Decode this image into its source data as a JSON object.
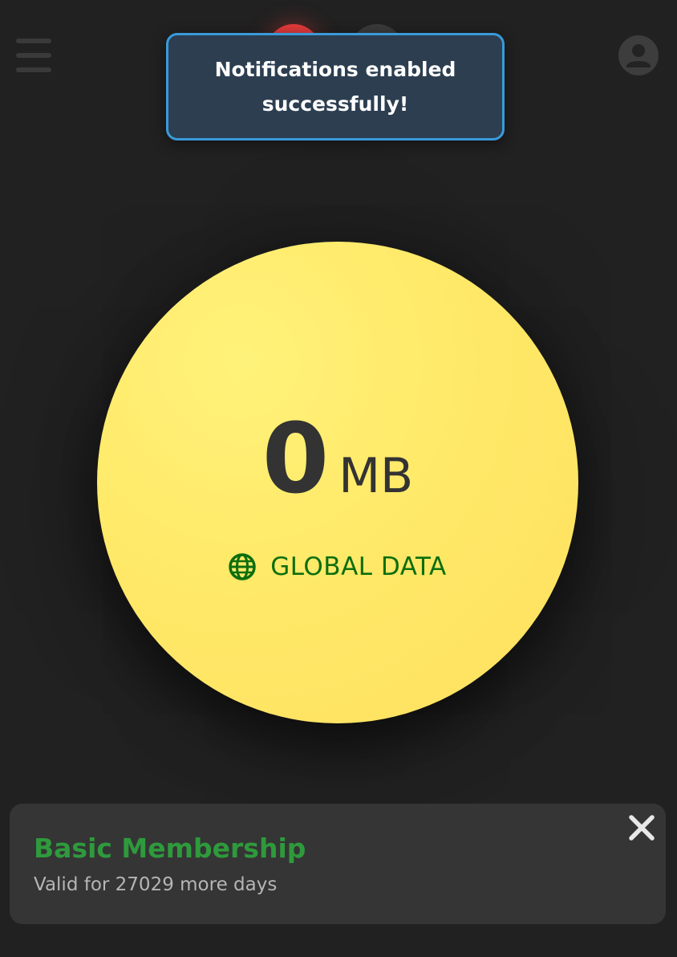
{
  "header": {
    "menu_icon": "hamburger-menu-icon",
    "avatar_icon": "user-account-icon",
    "nav_indicators": [
      {
        "name": "active-indicator",
        "color": "#e03a3a"
      },
      {
        "name": "inactive-indicator",
        "color": "#3a3a3a"
      }
    ]
  },
  "toast": {
    "message": "Notifications enabled successfully!",
    "border_color": "#3a9ad9",
    "background": "#2c3e50"
  },
  "usage": {
    "value": "0",
    "unit": "MB",
    "type_label": "GLOBAL DATA",
    "type_icon": "globe-icon",
    "circle_color": "#ffe968",
    "label_color": "#0d6e0d"
  },
  "membership": {
    "title": "Basic Membership",
    "subtitle": "Valid for 27029 more days",
    "title_color": "#2e9a3c",
    "close_icon": "close-icon"
  }
}
